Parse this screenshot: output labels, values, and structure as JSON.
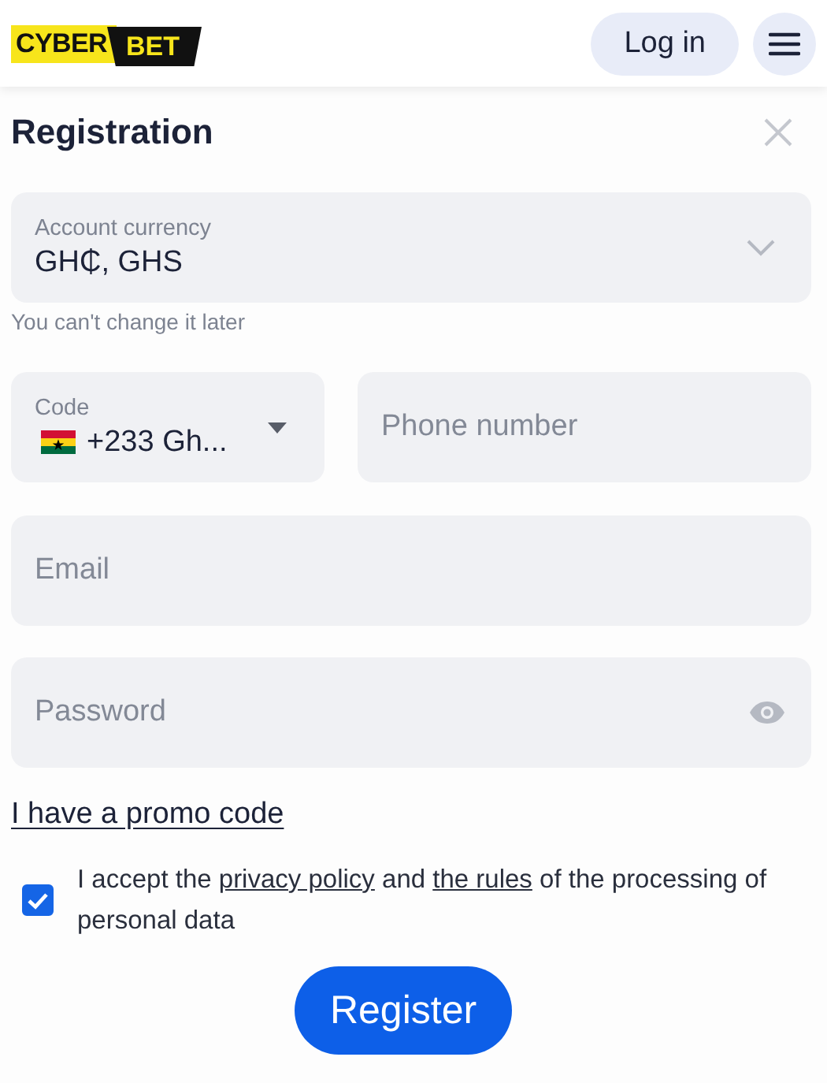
{
  "header": {
    "logo": [
      "CYBER",
      "BET"
    ],
    "login_button": "Log in"
  },
  "title": "Registration",
  "currency": {
    "label": "Account currency",
    "value": "GH₵, GHS",
    "hint": "You can't change it later"
  },
  "phone": {
    "code_label": "Code",
    "code_value": "+233 Gh...",
    "placeholder": "Phone number"
  },
  "email": {
    "placeholder": "Email"
  },
  "password": {
    "placeholder": "Password"
  },
  "promo_link": "I have a promo code",
  "consent": {
    "checked": true,
    "parts": [
      {
        "kind": "text",
        "text": "I accept the "
      },
      {
        "kind": "link",
        "text": "privacy policy"
      },
      {
        "kind": "text",
        "text": " and "
      },
      {
        "kind": "link",
        "text": "the rules"
      },
      {
        "kind": "text",
        "text": " of the processing of personal data"
      }
    ]
  },
  "register_button": "Register"
}
